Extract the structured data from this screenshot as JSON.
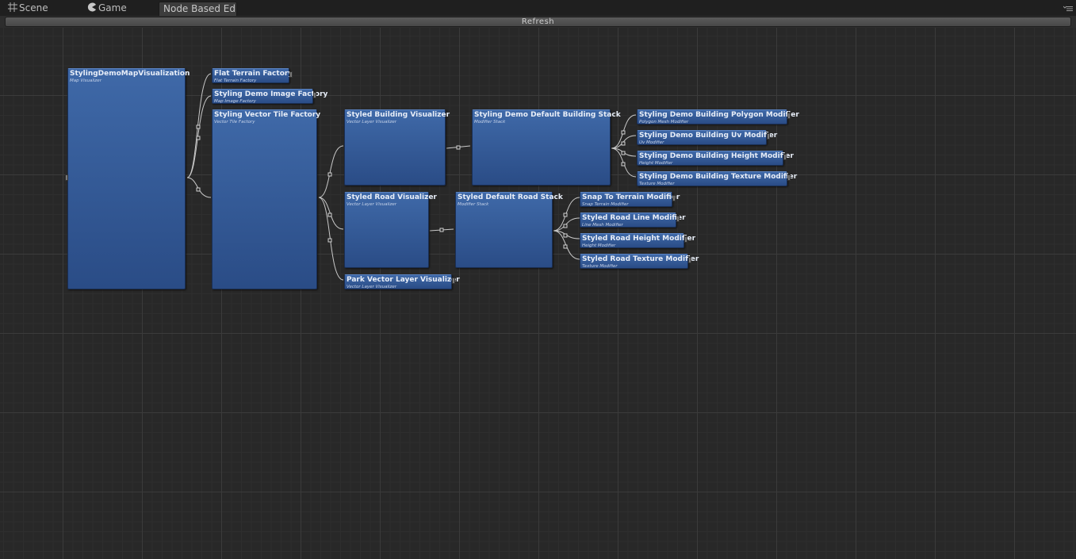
{
  "tabs": {
    "scene": "Scene",
    "game": "Game",
    "node_editor": "Node Based Ed"
  },
  "toolbar": {
    "refresh_label": "Refresh"
  },
  "icons": {
    "scene": "grid-icon",
    "game": "pacman-icon",
    "menu": "menu-icon"
  },
  "colors": {
    "node_top": "#3f69a8",
    "node_bottom": "#2a4c86",
    "wire": "#c8c8c8",
    "canvas": "#282828"
  },
  "nodes": {
    "map_visualization": {
      "title": "StylingDemoMapVisualization",
      "type": "Map Visualizer"
    },
    "flat_terrain_factory": {
      "title": "Flat Terrain Factory",
      "type": "Flat Terrain Factory"
    },
    "image_factory": {
      "title": "Styling Demo Image Factory",
      "type": "Map Image Factory"
    },
    "vector_tile_factory": {
      "title": "Styling Vector Tile Factory",
      "type": "Vector Tile Factory"
    },
    "building_visualizer": {
      "title": "Styled Building Visualizer",
      "type": "Vector Layer Visualizer"
    },
    "building_stack": {
      "title": "Styling Demo Default Building Stack",
      "type": "Modifier Stack"
    },
    "building_polygon_modifier": {
      "title": "Styling Demo Building Polygon Modifier",
      "type": "Polygon Mesh Modifier"
    },
    "building_uv_modifier": {
      "title": "Styling Demo Building Uv Modifier",
      "type": "Uv Modifier"
    },
    "building_height_modifier": {
      "title": "Styling Demo Building Height Modifier",
      "type": "Height Modifier"
    },
    "building_texture_modifier": {
      "title": "Styling Demo Building Texture Modifier",
      "type": "Texture Modifier"
    },
    "road_visualizer": {
      "title": "Styled Road Visualizer",
      "type": "Vector Layer Visualizer"
    },
    "road_stack": {
      "title": "Styled Default Road Stack",
      "type": "Modifier Stack"
    },
    "snap_terrain_modifier": {
      "title": "Snap To Terrain Modifier",
      "type": "Snap Terrain Modifier"
    },
    "road_line_modifier": {
      "title": "Styled Road Line Modifier",
      "type": "Line Mesh Modifier"
    },
    "road_height_modifier": {
      "title": "Styled Road Height Modifier",
      "type": "Height Modifier"
    },
    "road_texture_modifier": {
      "title": "Styled Road Texture Modifier",
      "type": "Texture Modifier"
    },
    "park_visualizer": {
      "title": "Park Vector Layer Visualizer",
      "type": "Vector Layer Visualizer"
    }
  }
}
